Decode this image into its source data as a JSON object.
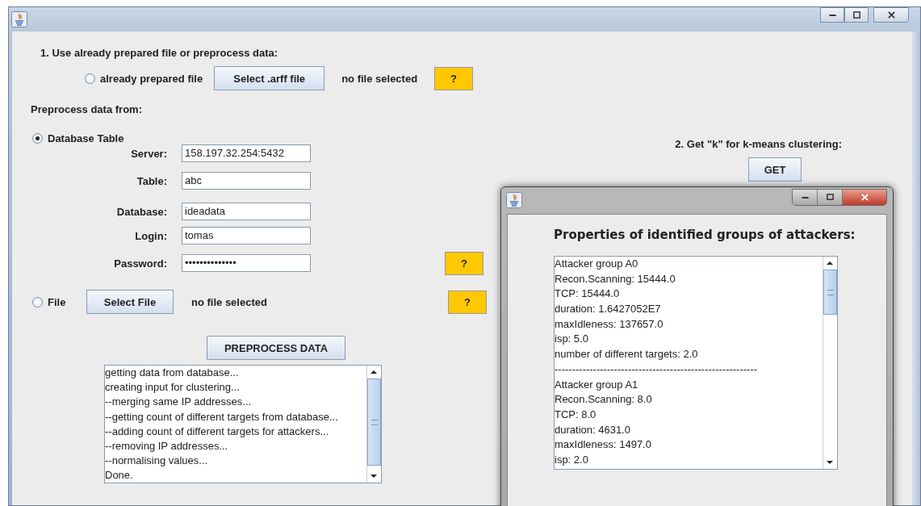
{
  "main_window": {
    "section_1": {
      "heading": "1. Use already prepared file or preprocess data:",
      "option": {
        "label": "already prepared file",
        "selected": false
      },
      "button": "Select .arff file",
      "status": "no file selected",
      "help": "?"
    },
    "preprocess": {
      "heading": "Preprocess data from:",
      "database": {
        "label": "Database Table",
        "selected": true
      },
      "fields": [
        {
          "label": "Server:",
          "value": "158.197.32.254:5432"
        },
        {
          "label": "Table:",
          "value": "abc"
        },
        {
          "label": "Database:",
          "value": "ideadata"
        },
        {
          "label": "Login:",
          "value": "tomas"
        },
        {
          "label": "Password:",
          "value": "••••••••••••••"
        }
      ],
      "database_help": "?",
      "file": {
        "label": "File",
        "selected": false
      },
      "file_button": "Select File",
      "file_status": "no file selected",
      "file_help": "?",
      "button": "PREPROCESS DATA",
      "log": [
        "getting data from database...",
        "creating input for clustering...",
        "--merging same IP addresses...",
        "--getting count of different targets from database...",
        "--adding count of different targets for attackers...",
        "--removing IP addresses...",
        "--normalising values...",
        "Done."
      ]
    },
    "section_2": {
      "heading": "2. Get \"k\" for k-means clustering:",
      "button": "GET"
    }
  },
  "dialog": {
    "heading": "Properties of identified groups of attackers:",
    "lines": [
      "Attacker group A0",
      "Recon.Scanning: 15444.0",
      "TCP: 15444.0",
      "duration: 1.6427052E7",
      "maxIdleness: 137657.0",
      "isp: 5.0",
      "number of different targets: 2.0",
      "----------------------------------------------------------",
      "Attacker group A1",
      "Recon.Scanning: 8.0",
      "TCP: 8.0",
      "duration: 4631.0",
      "maxIdleness: 1497.0",
      "isp: 2.0"
    ]
  }
}
